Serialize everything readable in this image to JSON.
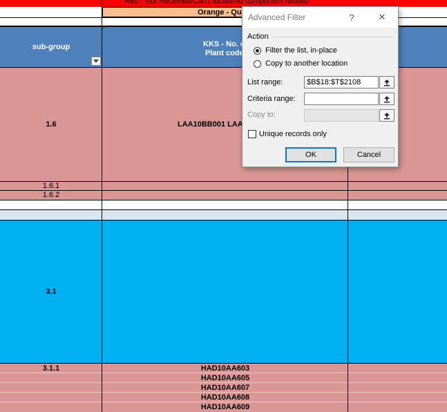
{
  "legend": {
    "red_text": "Red - Not Received/Can't locate/no component related",
    "orange_text": "Orange - Qu"
  },
  "header": {
    "subgroup": "sub-group",
    "kks_line1": "KKS - No. c",
    "kks_line2": "Plant code"
  },
  "rows": {
    "r16_subgroup": "1.6",
    "r16_kks": "LAA10BB001 LAA",
    "r161_subgroup": "1.6.1",
    "r162_subgroup": "1.6.2",
    "r31_subgroup": "3.1",
    "r311_subgroup": "3.1.1",
    "kks_list": [
      "HAD10AA603",
      "HAD10AA605",
      "HAD10AA607",
      "HAD10AA608",
      "HAD10AA609"
    ]
  },
  "dialog": {
    "title": "Advanced Filter",
    "help": "?",
    "close": "✕",
    "action_label": "Action",
    "radio_inplace": "Filter the list, in-place",
    "radio_copy": "Copy to another location",
    "list_range_label": "List range:",
    "list_range_value": "$B$18:$T$2108",
    "criteria_label": "Criteria range:",
    "criteria_value": "",
    "copyto_label": "Copy to:",
    "copyto_value": "",
    "unique_label": "Unique records only",
    "ok": "OK",
    "cancel": "Cancel"
  },
  "colors": {
    "red": "#ff0000",
    "orange": "#fabf8f",
    "pink": "#da9694",
    "blue": "#00b0f0",
    "header_blue": "#4f81bd"
  }
}
